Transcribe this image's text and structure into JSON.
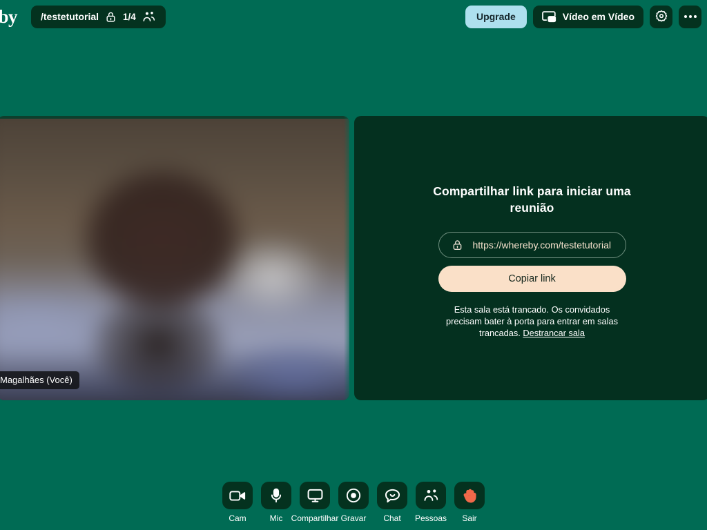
{
  "app": {
    "brand_logo_text": "reby",
    "bg_color": "#006b54",
    "panel_color": "#04301f",
    "accent_cream": "#fae0c8",
    "accent_blue": "#ade0ee",
    "leave_color": "#f0694a"
  },
  "topbar": {
    "room": {
      "name": "/testetutorial",
      "lock_icon": "lock-icon",
      "participant_count": "1/4",
      "people_icon": "people-icon"
    },
    "upgrade_label": "Upgrade",
    "pip_label": "Vídeo em Vídeo",
    "pip_icon": "picture-in-picture-icon",
    "settings_icon": "gear-icon",
    "more_icon": "more-options-icon"
  },
  "stage": {
    "video": {
      "participant_name": "Magalhães (Você)"
    },
    "share": {
      "title": "Compartilhar link para iniciar uma reunião",
      "link_lock_icon": "lock-icon",
      "link_url": "https://whereby.com/testetutorial",
      "copy_label": "Copiar link",
      "lock_note_text": "Esta sala está trancado. Os convidados precisam bater à porta para entrar em salas trancadas.",
      "unlock_link_label": "Destrancar sala"
    }
  },
  "toolbar": {
    "items": [
      {
        "label": "Cam",
        "icon": "camera-icon"
      },
      {
        "label": "Mic",
        "icon": "microphone-icon"
      },
      {
        "label": "Compartilhar",
        "icon": "screen-share-icon"
      },
      {
        "label": "Gravar",
        "icon": "record-icon"
      },
      {
        "label": "Chat",
        "icon": "chat-icon"
      },
      {
        "label": "Pessoas",
        "icon": "people-icon"
      },
      {
        "label": "Sair",
        "icon": "waving-hand-icon"
      }
    ]
  }
}
